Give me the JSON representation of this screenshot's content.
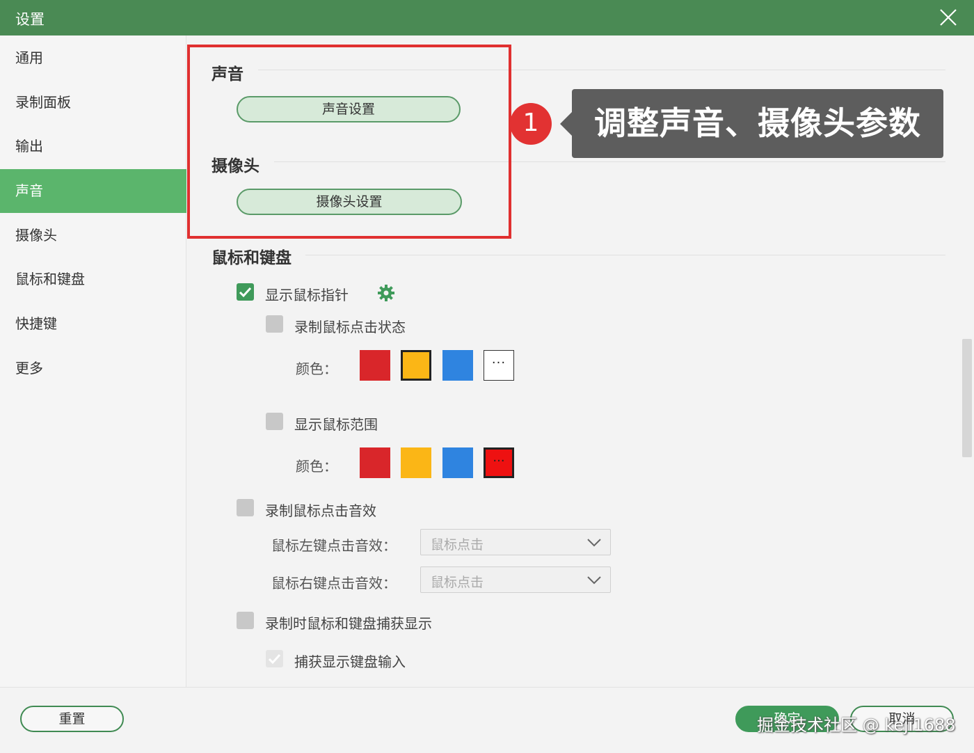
{
  "window": {
    "title": "设置"
  },
  "sidebar": {
    "items": [
      {
        "label": "通用"
      },
      {
        "label": "录制面板"
      },
      {
        "label": "输出"
      },
      {
        "label": "声音",
        "active": true
      },
      {
        "label": "摄像头"
      },
      {
        "label": "鼠标和键盘"
      },
      {
        "label": "快捷键"
      },
      {
        "label": "更多"
      }
    ]
  },
  "sound": {
    "title": "声音",
    "button": "声音设置"
  },
  "camera": {
    "title": "摄像头",
    "button": "摄像头设置"
  },
  "mouse_keyboard": {
    "title": "鼠标和键盘",
    "show_pointer": {
      "label": "显示鼠标指针",
      "checked": true
    },
    "record_click_state": {
      "label": "录制鼠标点击状态",
      "checked": false
    },
    "click_colors": {
      "label": "颜色：",
      "swatches": [
        "#d9262a",
        "#fbb616",
        "#2f84e0"
      ],
      "selected": "#fbb616",
      "more_label": "···"
    },
    "show_range": {
      "label": "显示鼠标范围",
      "checked": false
    },
    "range_colors": {
      "label": "颜色：",
      "swatches": [
        "#d9262a",
        "#fbb616",
        "#2f84e0",
        "#ee1111"
      ],
      "selected": "#ee1111",
      "selected_label": "···"
    },
    "click_sound": {
      "label": "录制鼠标点击音效",
      "checked": false
    },
    "left_sound": {
      "label": "鼠标左键点击音效：",
      "value": "鼠标点击"
    },
    "right_sound": {
      "label": "鼠标右键点击音效：",
      "value": "鼠标点击"
    },
    "capture_display": {
      "label": "录制时鼠标和键盘捕获显示",
      "checked": false
    },
    "capture_keyboard": {
      "label": "捕获显示键盘输入",
      "checked": true
    }
  },
  "annotation": {
    "step": "1",
    "text": "调整声音、摄像头参数",
    "color": "#e03030"
  },
  "footer": {
    "reset": "重置",
    "ok": "确定",
    "cancel": "取消",
    "watermark": "掘金技术社区 @ keji1688"
  },
  "colors": {
    "titlebar": "#4a8a54",
    "accent": "#5bb56c",
    "checkbox": "#3f9a5a"
  }
}
